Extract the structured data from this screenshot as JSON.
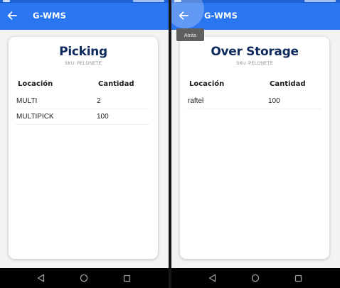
{
  "left_screen": {
    "app_title": "G-WMS",
    "card": {
      "title": "Picking",
      "sku": "SKU: PELONETE",
      "columns": [
        "Locación",
        "Cantidad"
      ],
      "rows": [
        {
          "location": "MULTI",
          "quantity": "2"
        },
        {
          "location": "MULTIPICK",
          "quantity": "100"
        }
      ]
    }
  },
  "right_screen": {
    "app_title": "G-WMS",
    "tooltip": "Atrás",
    "card": {
      "title": "Over Storage",
      "sku": "SKU: PELONETE",
      "columns": [
        "Locación",
        "Cantidad"
      ],
      "rows": [
        {
          "location": "raftel",
          "quantity": "100"
        }
      ]
    }
  },
  "colors": {
    "appbar": "#2a76f0",
    "title": "#0e2a5c",
    "background": "#f2f3f5"
  },
  "icons": {
    "appbar": "arrow-left",
    "navbar": [
      "triangle-back",
      "circle-home",
      "square-recents"
    ]
  }
}
